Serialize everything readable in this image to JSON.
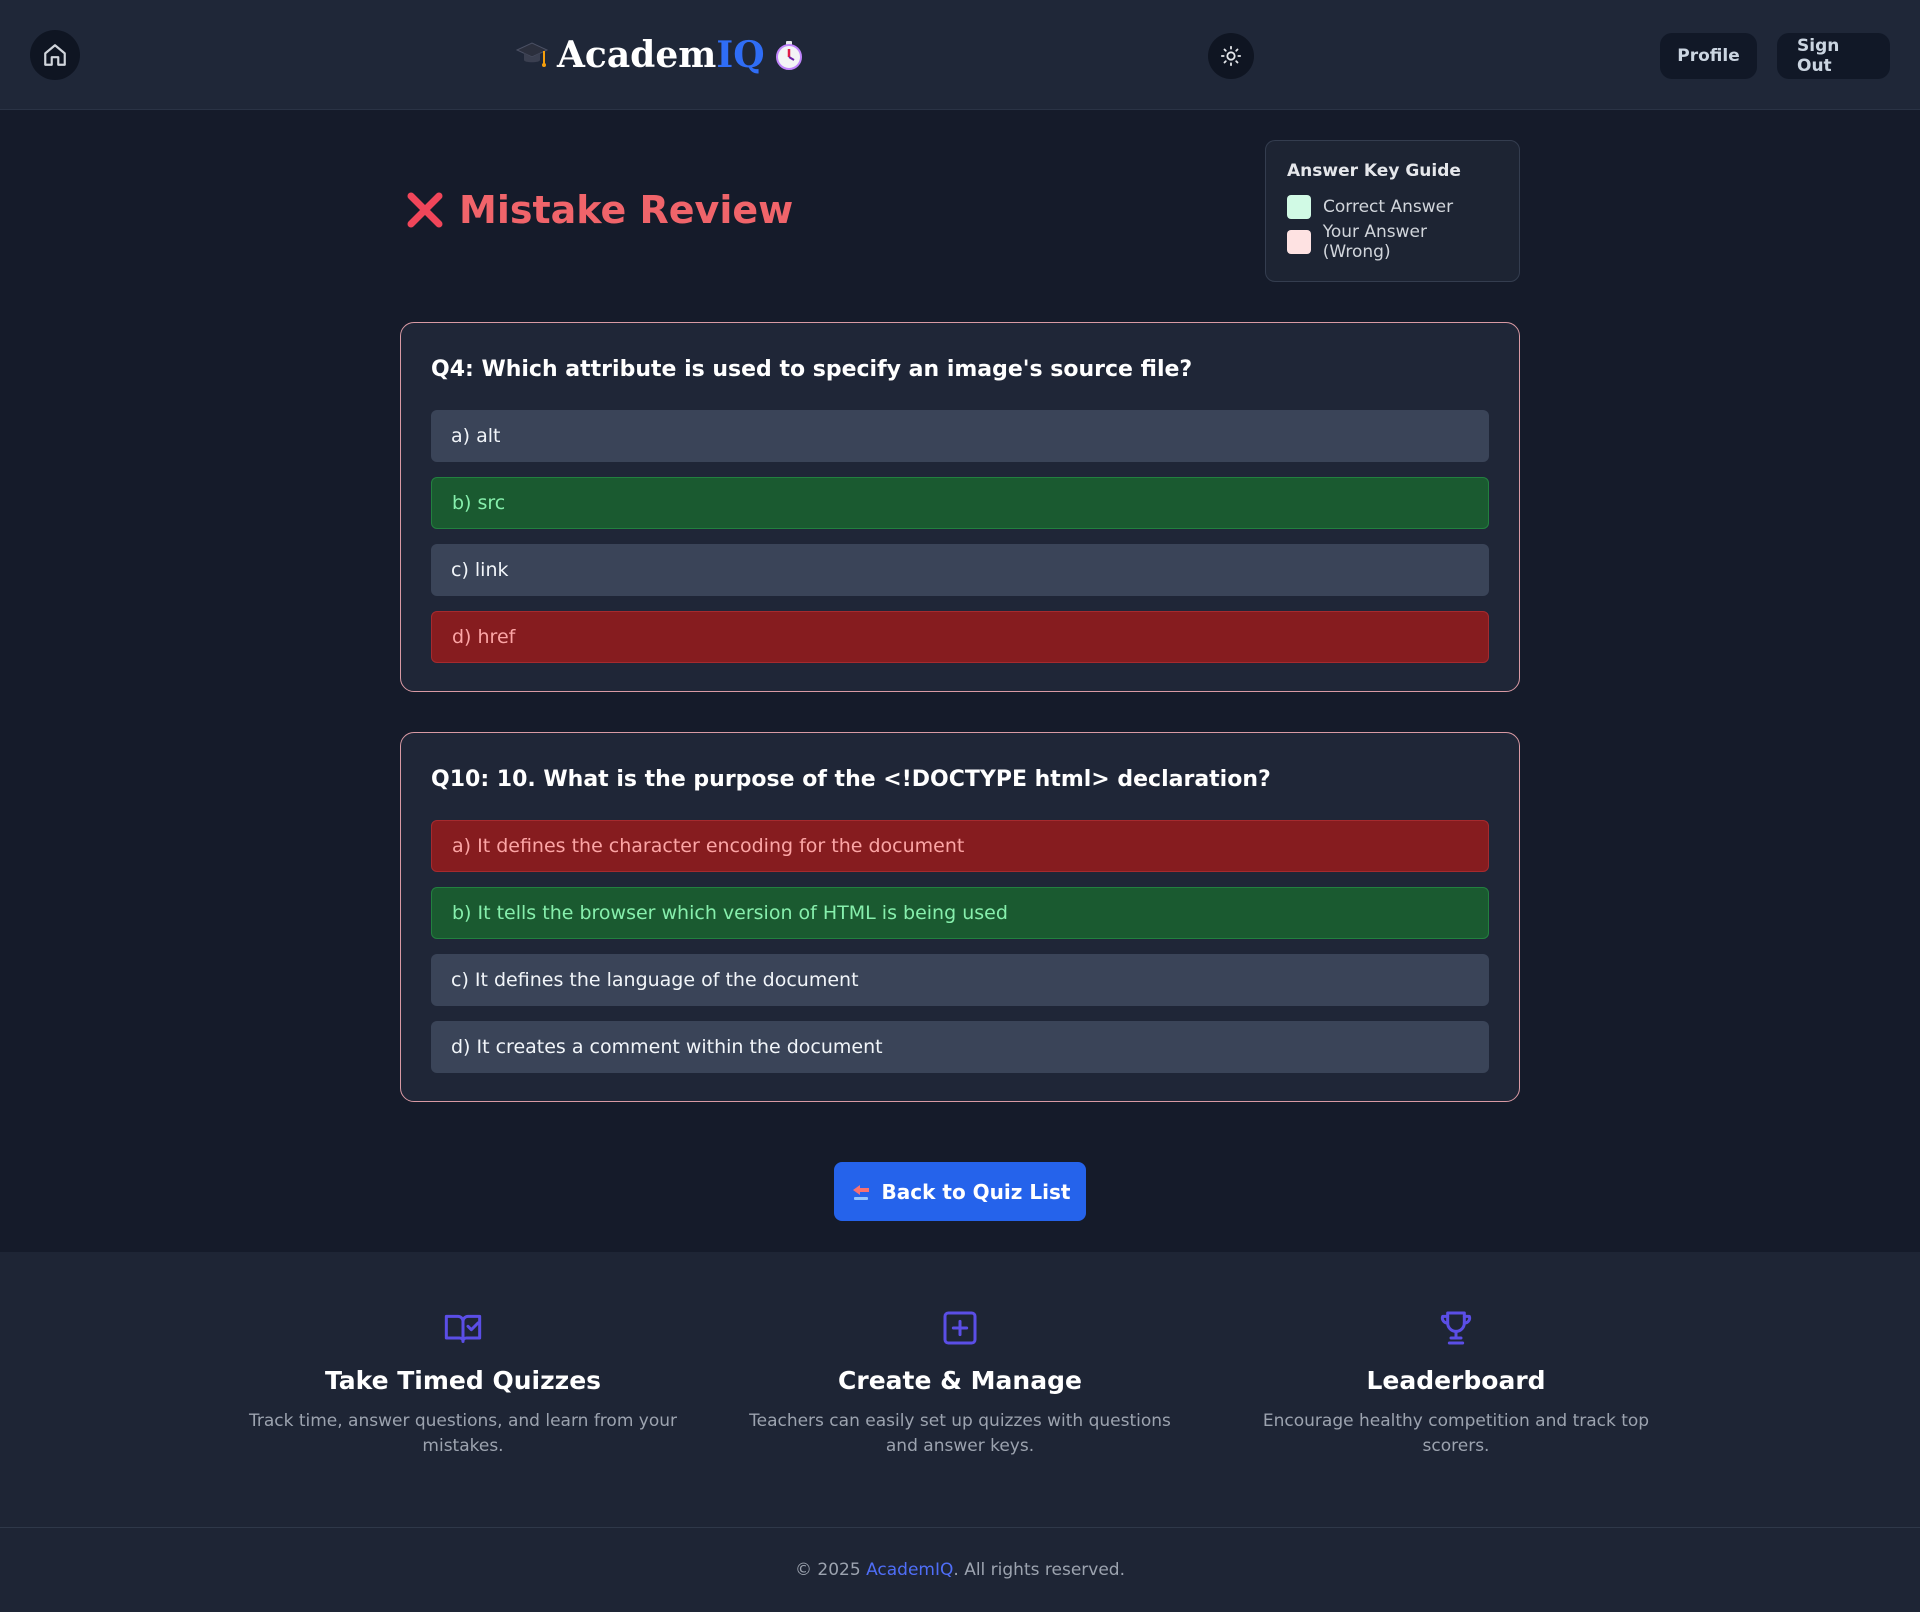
{
  "header": {
    "brand_left": "Academ",
    "brand_right": "IQ",
    "profile_label": "Profile",
    "signout_label": "Sign Out"
  },
  "page": {
    "title": "Mistake Review"
  },
  "guide": {
    "title": "Answer Key Guide",
    "correct_label": "Correct Answer",
    "wrong_label": "Your Answer (Wrong)"
  },
  "questions": [
    {
      "text": "Q4: Which attribute is used to specify an image's source file?",
      "options": [
        {
          "label": "a) alt",
          "state": "neutral"
        },
        {
          "label": "b) src",
          "state": "correct"
        },
        {
          "label": "c) link",
          "state": "neutral"
        },
        {
          "label": "d) href",
          "state": "wrong"
        }
      ]
    },
    {
      "text": "Q10: 10. What is the purpose of the <!DOCTYPE html> declaration?",
      "options": [
        {
          "label": "a) It defines the character encoding for the document",
          "state": "wrong"
        },
        {
          "label": "b) It tells the browser which version of HTML is being used",
          "state": "correct"
        },
        {
          "label": "c) It defines the language of the document",
          "state": "neutral"
        },
        {
          "label": "d) It creates a comment within the document",
          "state": "neutral"
        }
      ]
    }
  ],
  "back_button": {
    "label": "Back to Quiz List"
  },
  "features": [
    {
      "icon": "book-check-icon",
      "title": "Take Timed Quizzes",
      "desc": "Track time, answer questions, and learn from your mistakes."
    },
    {
      "icon": "plus-square-icon",
      "title": "Create & Manage",
      "desc": "Teachers can easily set up quizzes with questions and answer keys."
    },
    {
      "icon": "trophy-icon",
      "title": "Leaderboard",
      "desc": "Encourage healthy competition and track top scorers."
    }
  ],
  "footer": {
    "prefix": "© 2025 ",
    "brand": "AcademIQ",
    "suffix": ". All rights reserved."
  },
  "colors": {
    "accent": "#2563eb",
    "title_red": "#f0646a",
    "correct_bg": "#1a5a30",
    "wrong_bg": "#861c1f"
  }
}
